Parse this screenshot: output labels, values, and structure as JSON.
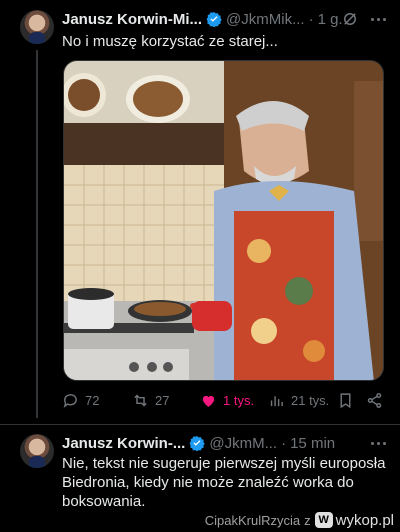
{
  "tweet1": {
    "author_name": "Janusz Korwin-Mi...",
    "handle": "@JkmMik...",
    "separator": "·",
    "time": "1 g.",
    "text": "No i muszę korzystać ze starej...",
    "stats": {
      "replies": "72",
      "retweets": "27",
      "likes": "1 tys.",
      "views": "21 tys."
    }
  },
  "tweet2": {
    "author_name": "Janusz Korwin-...",
    "handle": "@JkmM...",
    "separator": "·",
    "time": "15 min",
    "text": "Nie, tekst nie sugeruje pierwszej myśli europosła Biedronia, kiedy nie może znaleźć worka do boksowania."
  },
  "footer": {
    "username": "CipakKrulRzycia",
    "connector": "z",
    "site": "wykop.pl",
    "badge": "W"
  },
  "colors": {
    "background": "#000000",
    "text_primary": "#e7e9ea",
    "text_secondary": "#71767b",
    "verified": "#1d9bf0",
    "like": "#f91880"
  },
  "icons": [
    "verified-icon",
    "grok-icon",
    "more-icon",
    "reply-icon",
    "retweet-icon",
    "heart-icon",
    "views-icon",
    "bookmark-icon",
    "share-icon"
  ]
}
